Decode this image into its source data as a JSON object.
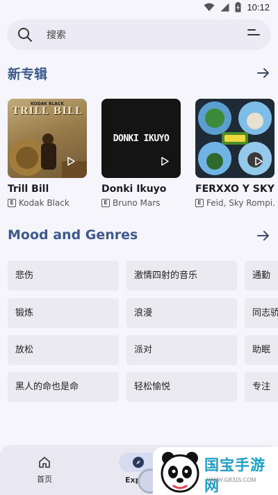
{
  "status_bar": {
    "time": "10:12"
  },
  "search": {
    "placeholder": "搜索"
  },
  "new_albums": {
    "title": "新专辑",
    "items": [
      {
        "title": "Trill Bill",
        "artist": "Kodak Black",
        "cover_text": "TRILL BILL",
        "cover_subtext": "KODAK BLACK"
      },
      {
        "title": "Donki Ikuyo",
        "artist": "Bruno Mars",
        "cover_text": "DONKI IKUYO"
      },
      {
        "title": "FERXXO Y SKY R",
        "artist": "Feid, Sky Rompi..."
      }
    ],
    "explicit_label": "E"
  },
  "mood": {
    "title": "Mood and Genres",
    "items": [
      "悲伤",
      "激情四射的音乐",
      "通勤",
      "锻炼",
      "浪漫",
      "同志骄",
      "放松",
      "派对",
      "助眠",
      "黑人的命也是命",
      "轻松愉悦",
      "专注"
    ]
  },
  "nav": {
    "home": "首页",
    "explore": "Explo"
  },
  "watermark": {
    "text": "国宝手游网",
    "url": "WWW.GB315.COM"
  },
  "colors": {
    "accent": "#3d5a8c",
    "watermark": "#1a9fc9"
  }
}
